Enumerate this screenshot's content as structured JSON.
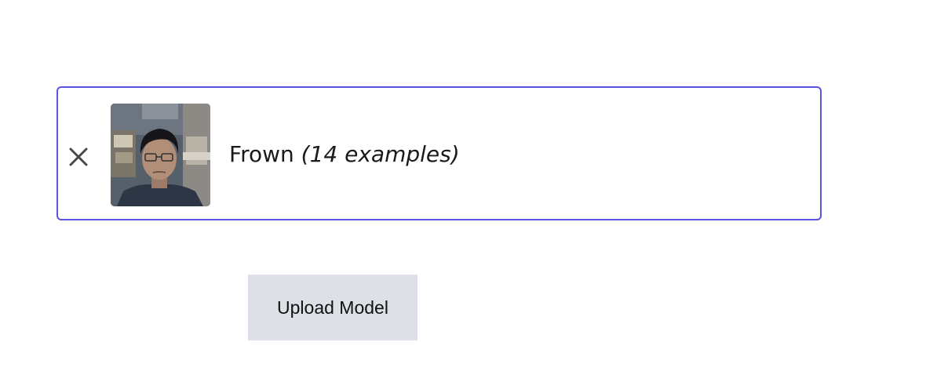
{
  "class_card": {
    "name": "Frown",
    "example_count": "(14 examples)",
    "border_color": "#5b54e0",
    "remove_icon": "close-icon",
    "thumbnail": "webcam-face-thumbnail"
  },
  "actions": {
    "upload_label": "Upload Model",
    "upload_bg": "#dde1e7"
  }
}
